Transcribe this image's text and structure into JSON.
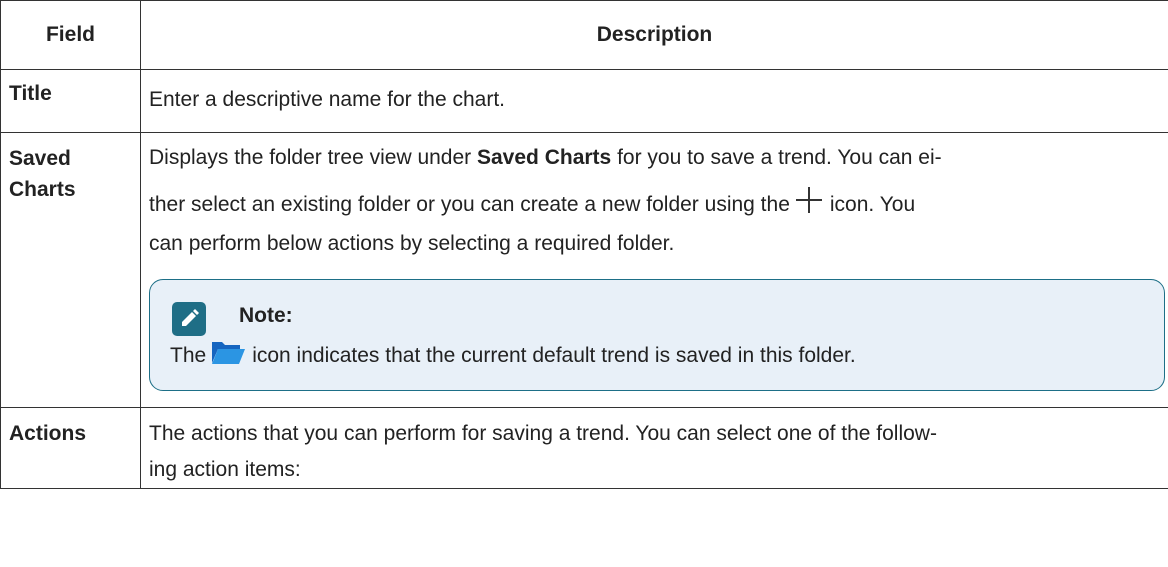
{
  "table": {
    "headers": {
      "field": "Field",
      "description": "Description"
    },
    "rows": {
      "title": {
        "field": "Title",
        "desc": "Enter a descriptive name for the chart."
      },
      "saved_charts": {
        "field_line1": "Saved",
        "field_line2": "Charts",
        "desc_l1_pre": "Displays the folder tree view under ",
        "desc_l1_bold": "Saved Charts",
        "desc_l1_post": " for you to save a trend. You can ei-",
        "desc_l2_pre": "ther select an existing folder or you can create a new folder using the",
        "desc_l2_post": "icon. You",
        "desc_l3": "can perform below actions by selecting a required folder.",
        "plus_icon": "plus-icon",
        "note": {
          "label": "Note:",
          "icon": "pencil-icon",
          "text_pre": "The",
          "folder_icon": "folder-open-icon",
          "text_post": "icon indicates that the current default trend is saved in this folder."
        }
      },
      "actions": {
        "field": "Actions",
        "desc_l1": "The actions that you can perform for saving a trend. You can select one of the follow-",
        "desc_l2": "ing action items:"
      }
    }
  },
  "colors": {
    "note_border": "#1d6f87",
    "note_background": "#e8f0f8",
    "note_icon": "#1f6e86",
    "folder_icon": "#1e88d8"
  }
}
